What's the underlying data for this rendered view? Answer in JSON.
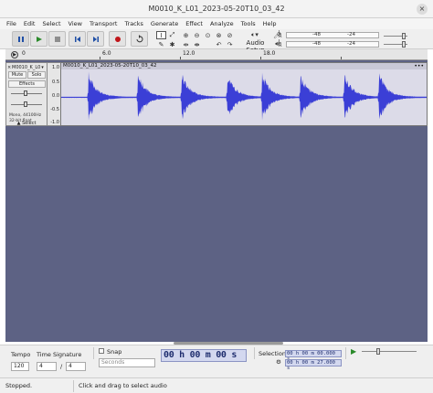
{
  "window": {
    "title": "M0010_K_L01_2023-05-20T10_03_42",
    "close_glyph": "×"
  },
  "menu": [
    "File",
    "Edit",
    "Select",
    "View",
    "Transport",
    "Tracks",
    "Generate",
    "Effect",
    "Analyze",
    "Tools",
    "Help"
  ],
  "toolbar": {
    "audio_setup_label": "Audio Setup",
    "meter_L": "L",
    "meter_R": "R",
    "meter_ticks": [
      "-48",
      "-24"
    ]
  },
  "timeline": {
    "labels": [
      "0",
      "6.0",
      "12.0",
      "18.0"
    ],
    "play_glyph": "▶"
  },
  "track": {
    "name": "M0010_K_L0",
    "mute_label": "Mute",
    "solo_label": "Solo",
    "effects_label": "Effects",
    "info_line1": "Mono, 44100Hz",
    "info_line2": "32-bit float",
    "select_label": "Select",
    "scale_labels": [
      "1.0",
      "0.5",
      "0.0",
      "-0.5",
      "-1.0"
    ]
  },
  "clip": {
    "name": "M0010_K_L01_2023-05-20T10_03_42",
    "menu_glyph": "•••",
    "wave_color": "#3b3fd6"
  },
  "bottom": {
    "tempo_label": "Tempo",
    "time_signature_label": "Time Signature",
    "tempo_value": "120",
    "ts_num": "4",
    "ts_sep": "/",
    "ts_den": "4",
    "snap_label": "Snap",
    "snap_unit": "Seconds",
    "time_display": "00 h 00 m 00 s",
    "selection_label": "Selection",
    "sel_start": "00 h 00 m 00.000 s",
    "sel_end": "00 h 00 m 27.000 s"
  },
  "status": {
    "state": "Stopped.",
    "hint": "Click and drag to select audio"
  }
}
